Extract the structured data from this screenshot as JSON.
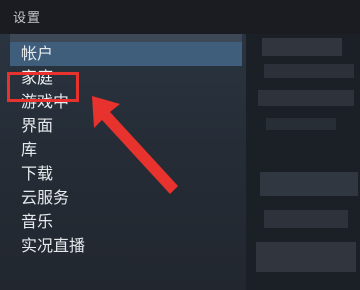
{
  "window": {
    "title": "设置"
  },
  "sidebar": {
    "items": [
      {
        "label": "帐户",
        "selected": true
      },
      {
        "label": "家庭",
        "selected": false,
        "annotated": true
      },
      {
        "label": "游戏中",
        "selected": false
      },
      {
        "label": "界面",
        "selected": false
      },
      {
        "label": "库",
        "selected": false
      },
      {
        "label": "下载",
        "selected": false
      },
      {
        "label": "云服务",
        "selected": false
      },
      {
        "label": "音乐",
        "selected": false
      },
      {
        "label": "实况直播",
        "selected": false
      }
    ]
  },
  "annotation": {
    "box_color": "#e8322d",
    "arrow_color": "#e8322d"
  },
  "colors": {
    "selected_bg": "#3f5e7b",
    "sidebar_bg": "#252c36",
    "titlebar_bg": "#1b1c22"
  }
}
